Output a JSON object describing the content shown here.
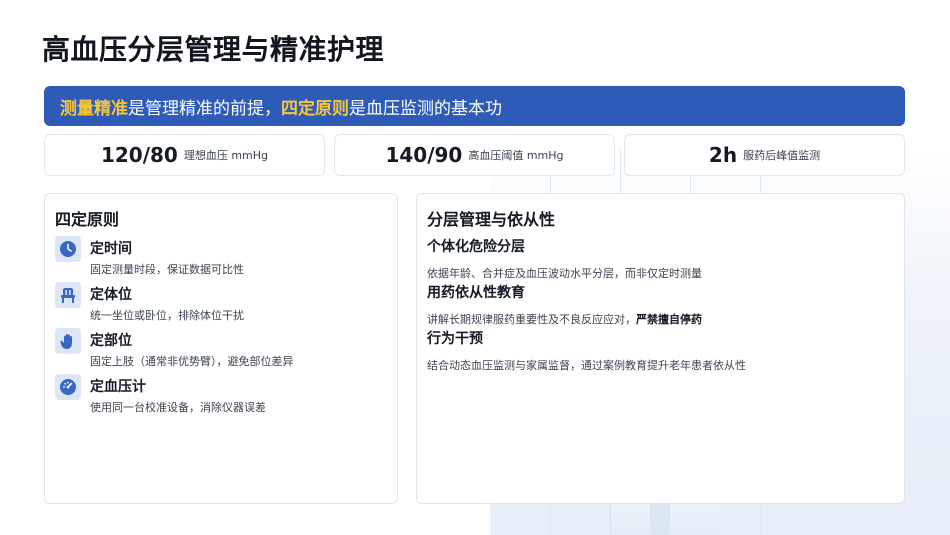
{
  "title": "高血压分层管理与精准护理",
  "banner": {
    "hl1": "测量精准",
    "t1": "是管理精准的前提，",
    "hl2": "四定原则",
    "t2": "是血压监测的基本功"
  },
  "stats": [
    {
      "value": "120/80",
      "label": "理想血压  mmHg"
    },
    {
      "value": "140/90",
      "label": "高血压阈值  mmHg"
    },
    {
      "value": "2h",
      "label": "服药后峰值监测"
    }
  ],
  "left": {
    "title": "四定原则",
    "items": [
      {
        "icon": "clock-icon",
        "heading": "定时间",
        "desc": "固定测量时段，保证数据可比性"
      },
      {
        "icon": "chair-icon",
        "heading": "定体位",
        "desc": "统一坐位或卧位，排除体位干扰"
      },
      {
        "icon": "hand-icon",
        "heading": "定部位",
        "desc": "固定上肢（通常非优势臂），避免部位差异"
      },
      {
        "icon": "gauge-icon",
        "heading": "定血压计",
        "desc": "使用同一台校准设备，消除仪器误差"
      }
    ]
  },
  "right": {
    "title": "分层管理与依从性",
    "items": [
      {
        "heading": "个体化危险分层",
        "desc": "依据年龄、合并症及血压波动水平分层，而非仅定时测量"
      },
      {
        "heading": "用药依从性教育",
        "desc": "讲解长期规律服药重要性及不良反应应对，",
        "desc_bold": "严禁擅自停药"
      },
      {
        "heading": "行为干预",
        "desc": "结合动态血压监测与家属监督，通过案例教育提升老年患者依从性"
      }
    ]
  },
  "colors": {
    "accent": "#2e5bb8",
    "highlight": "#f7c63a",
    "icon": "#3a66c4"
  }
}
